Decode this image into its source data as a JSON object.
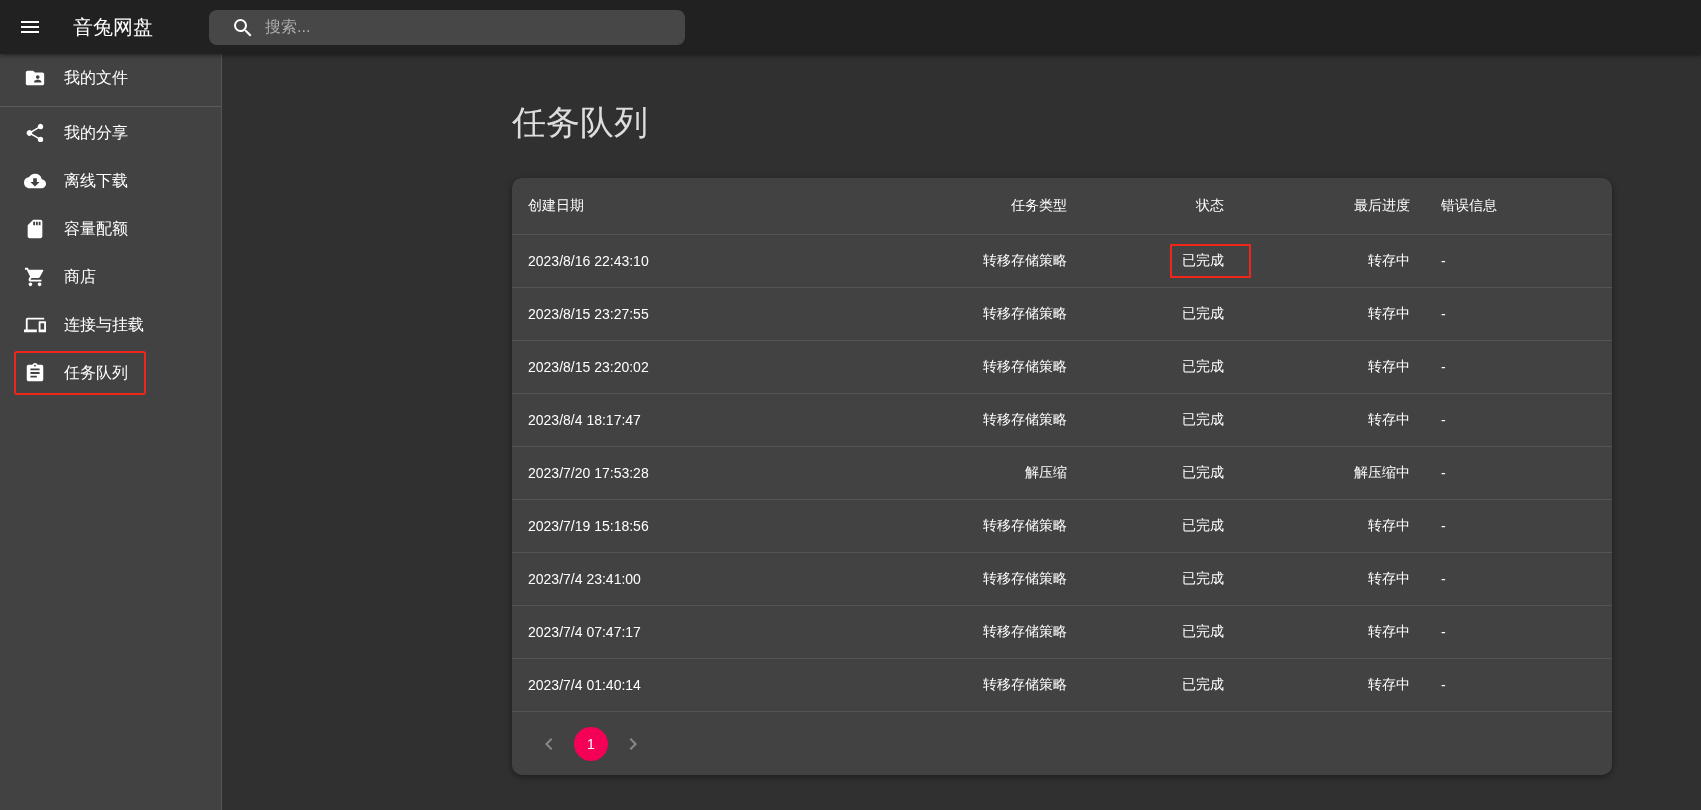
{
  "app_bar": {
    "title": "音兔网盘",
    "search": {
      "placeholder": "搜索..."
    }
  },
  "sidebar": {
    "items": [
      {
        "label": "我的文件",
        "highlighted": false
      },
      {
        "label": "我的分享",
        "highlighted": false
      },
      {
        "label": "离线下载",
        "highlighted": false
      },
      {
        "label": "容量配额",
        "highlighted": false
      },
      {
        "label": "商店",
        "highlighted": false
      },
      {
        "label": "连接与挂载",
        "highlighted": false
      },
      {
        "label": "任务队列",
        "highlighted": true
      }
    ]
  },
  "page_title": "任务队列",
  "table": {
    "columns": [
      "创建日期",
      "任务类型",
      "状态",
      "最后进度",
      "错误信息"
    ],
    "rows": [
      {
        "cells": [
          "2023/8/16 22:43:10",
          "转移存储策略",
          "已完成",
          "转存中",
          "-"
        ],
        "status_highlighted": true
      },
      {
        "cells": [
          "2023/8/15 23:27:55",
          "转移存储策略",
          "已完成",
          "转存中",
          "-"
        ],
        "status_highlighted": false
      },
      {
        "cells": [
          "2023/8/15 23:20:02",
          "转移存储策略",
          "已完成",
          "转存中",
          "-"
        ],
        "status_highlighted": false
      },
      {
        "cells": [
          "2023/8/4 18:17:47",
          "转移存储策略",
          "已完成",
          "转存中",
          "-"
        ],
        "status_highlighted": false
      },
      {
        "cells": [
          "2023/7/20 17:53:28",
          "解压缩",
          "已完成",
          "解压缩中",
          "-"
        ],
        "status_highlighted": false
      },
      {
        "cells": [
          "2023/7/19 15:18:56",
          "转移存储策略",
          "已完成",
          "转存中",
          "-"
        ],
        "status_highlighted": false
      },
      {
        "cells": [
          "2023/7/4 23:41:00",
          "转移存储策略",
          "已完成",
          "转存中",
          "-"
        ],
        "status_highlighted": false
      },
      {
        "cells": [
          "2023/7/4 07:47:17",
          "转移存储策略",
          "已完成",
          "转存中",
          "-"
        ],
        "status_highlighted": false
      },
      {
        "cells": [
          "2023/7/4 01:40:14",
          "转移存储策略",
          "已完成",
          "转存中",
          "-"
        ],
        "status_highlighted": false
      }
    ]
  },
  "pagination": {
    "prev_disabled": true,
    "next_disabled": true,
    "pages": [
      {
        "label": "1",
        "selected": true
      }
    ]
  }
}
